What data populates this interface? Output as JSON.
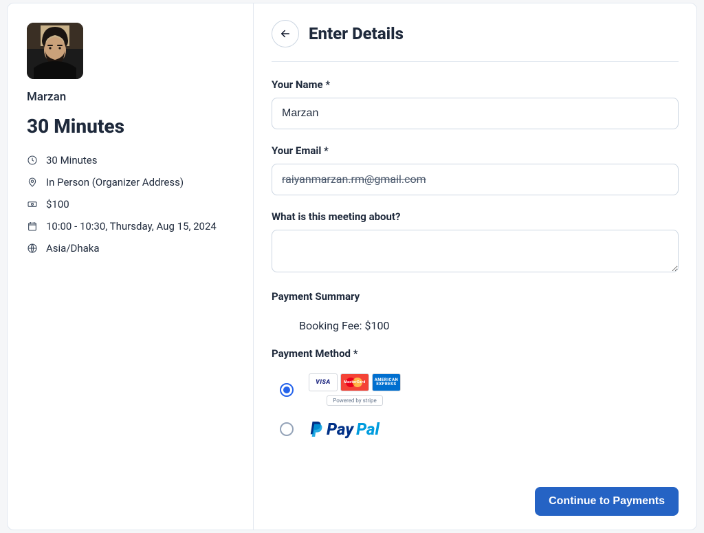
{
  "sidebar": {
    "host_name": "Marzan",
    "event_title": "30 Minutes",
    "duration": "30 Minutes",
    "location": "In Person (Organizer Address)",
    "price": "$100",
    "datetime": "10:00 - 10:30, Thursday, Aug 15, 2024",
    "timezone": "Asia/Dhaka"
  },
  "header": {
    "title": "Enter Details"
  },
  "form": {
    "name_label": "Your Name *",
    "name_value": "Marzan",
    "email_label": "Your Email *",
    "email_value": "raiyanmarzan.rm@gmail.com",
    "about_label": "What is this meeting about?",
    "about_value": "",
    "payment_summary_label": "Payment Summary",
    "booking_fee_text": "Booking Fee: $100",
    "payment_method_label": "Payment Method *",
    "methods": {
      "stripe": {
        "selected": true,
        "cards": {
          "visa": "VISA",
          "mastercard": "MasterCard",
          "amex": "AMERICAN EXPRESS"
        },
        "powered_by": "Powered by stripe"
      },
      "paypal": {
        "selected": false,
        "brand_pay": "Pay",
        "brand_pal": "Pal"
      }
    }
  },
  "footer": {
    "continue_label": "Continue to Payments"
  }
}
